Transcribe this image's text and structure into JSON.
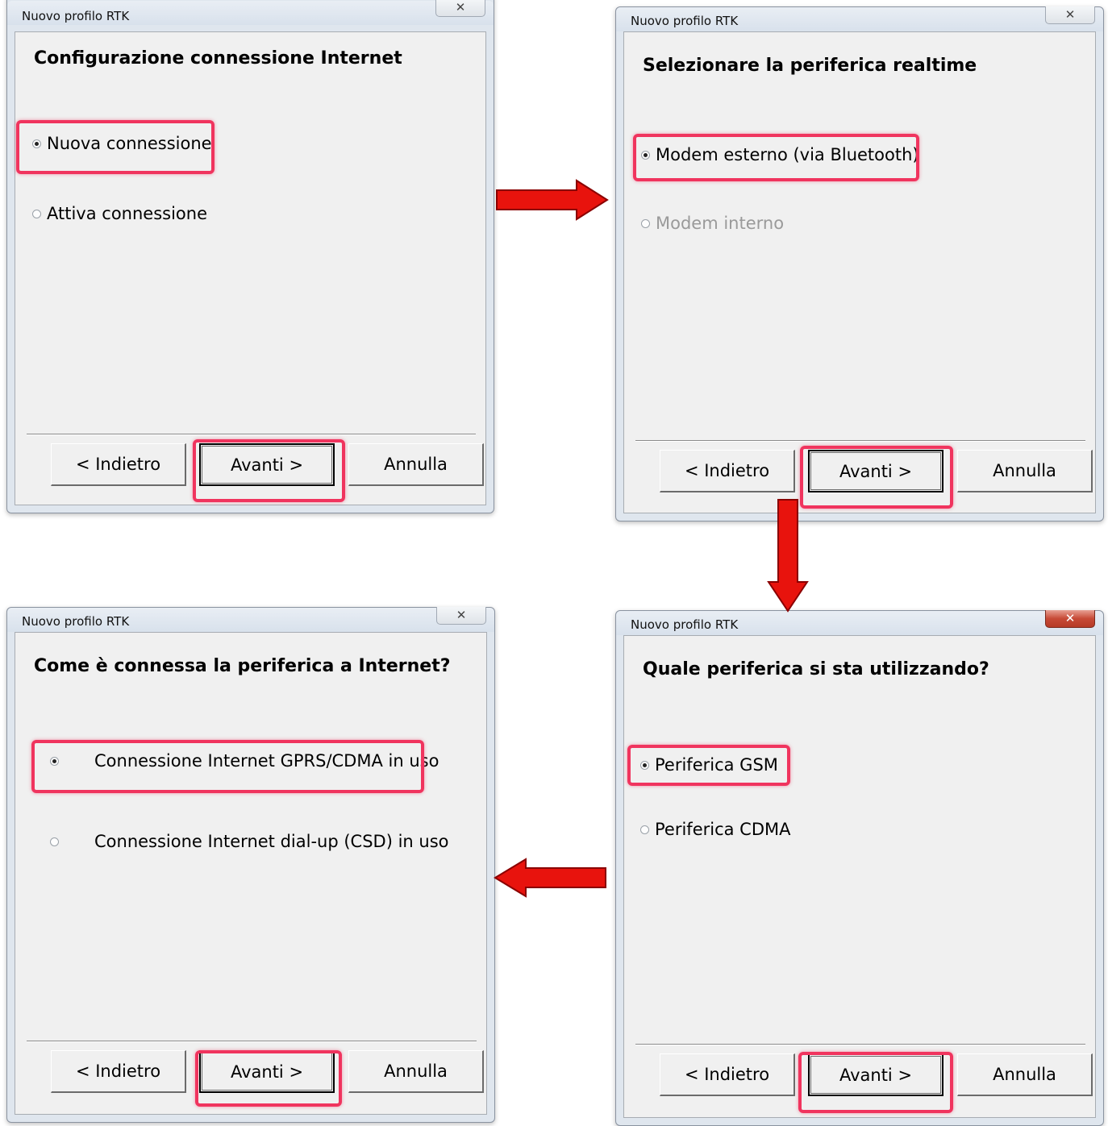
{
  "colors": {
    "highlight": "#f0345e",
    "arrow": "#e8130d",
    "arrow_outline": "#8a0000"
  },
  "dialogs": [
    {
      "title": "Nuovo profilo RTK",
      "close_icon": "close-x-icon",
      "heading": "Configurazione connessione Internet",
      "options": [
        {
          "label": "Nuova connessione",
          "checked": true
        },
        {
          "label": "Attiva connessione",
          "checked": false
        }
      ],
      "buttons": {
        "back": "< Indietro",
        "next": "Avanti >",
        "cancel": "Annulla"
      }
    },
    {
      "title": "Nuovo profilo RTK",
      "close_icon": "close-x-icon",
      "heading": "Selezionare la periferica realtime",
      "options": [
        {
          "label": "Modem esterno (via Bluetooth)",
          "checked": true
        },
        {
          "label": "Modem interno",
          "checked": false,
          "disabled": true
        }
      ],
      "buttons": {
        "back": "< Indietro",
        "next": "Avanti >",
        "cancel": "Annulla"
      }
    },
    {
      "title": "Nuovo profilo RTK",
      "close_icon": "close-x-icon",
      "heading": "Come è connessa la periferica a Internet?",
      "options": [
        {
          "label": "Connessione Internet GPRS/CDMA in uso",
          "checked": true
        },
        {
          "label": "Connessione Internet dial-up (CSD) in uso",
          "checked": false
        }
      ],
      "buttons": {
        "back": "< Indietro",
        "next": "Avanti >",
        "cancel": "Annulla"
      }
    },
    {
      "title": "Nuovo profilo RTK",
      "close_icon": "close-x-icon",
      "heading": "Quale periferica si sta utilizzando?",
      "options": [
        {
          "label": "Periferica GSM",
          "checked": true
        },
        {
          "label": "Periferica CDMA",
          "checked": false
        }
      ],
      "buttons": {
        "back": "< Indietro",
        "next": "Avanti >",
        "cancel": "Annulla"
      }
    }
  ],
  "close_glyph": "✕"
}
